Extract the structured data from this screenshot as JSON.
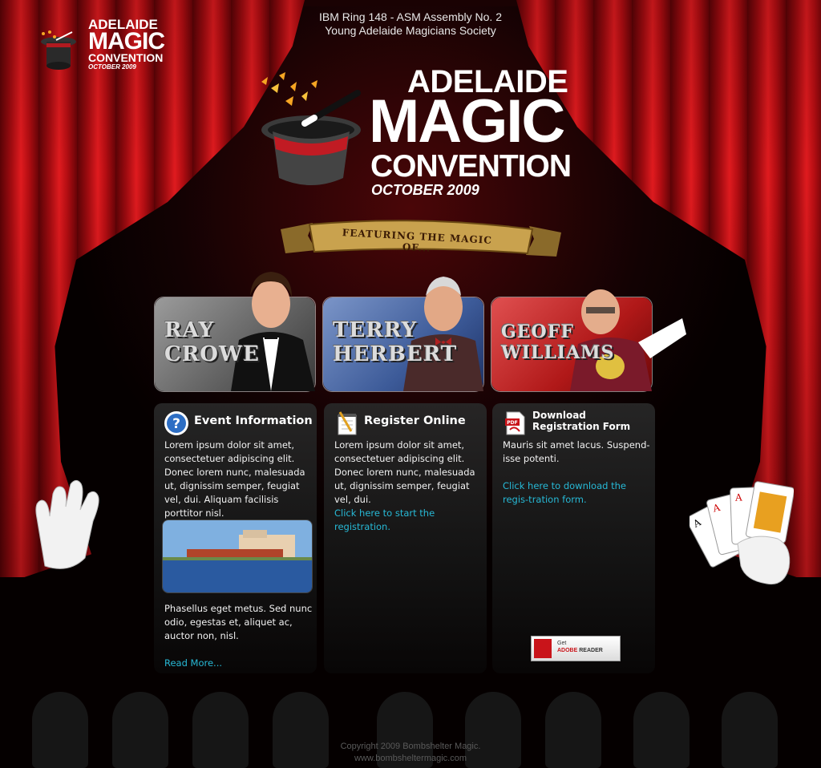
{
  "header": {
    "org_line1": "IBM Ring 148 - ASM Assembly No. 2",
    "org_line2": "Young Adelaide Magicians Society"
  },
  "logo_small": {
    "line1": "ADELAIDE",
    "line2": "MAGIC",
    "line3": "CONVENTION",
    "line4": "OCTOBER 2009"
  },
  "main_logo": {
    "line1": "ADELAIDE",
    "line2": "MAGIC",
    "line3": "CONVENTION",
    "line4": "OCTOBER 2009"
  },
  "banner": {
    "text": "FEATURING THE MAGIC OF..."
  },
  "magicians": [
    {
      "first": "RAY",
      "last": "CROWE"
    },
    {
      "first": "TERRY",
      "last": "HERBERT"
    },
    {
      "first": "GEOFF",
      "last": "WILLIAMS"
    }
  ],
  "panels": {
    "event": {
      "title": "Event Information",
      "icon": "question-icon",
      "text": "Lorem ipsum dolor sit amet, consectetuer adipiscing elit. Donec lorem nunc, malesuada ut, dignissim semper, feugiat vel, dui. Aliquam facilisis porttitor nisl.",
      "text2": "Phasellus eget metus. Sed nunc odio, egestas et, aliquet ac, auctor non, nisl.",
      "link": "Read More..."
    },
    "register": {
      "title": "Register Online",
      "icon": "notepad-icon",
      "text": "Lorem ipsum dolor sit amet, consectetuer adipiscing elit. Donec lorem nunc, malesuada ut, dignissim semper, feugiat vel, dui.",
      "link": "Click here to start the registration."
    },
    "download": {
      "title_line1": "Download",
      "title_line2": "Registration Form",
      "icon": "pdf-icon",
      "text": "Mauris sit amet lacus. Suspend-isse potenti.",
      "link": "Click here to download the regis-tration form.",
      "adobe_get": "Get",
      "adobe_brand": "ADOBE",
      "adobe_reader": "READER"
    }
  },
  "footer": {
    "line1": "Copyright  2009 Bombshelter Magic.",
    "line2": "www.bombsheltermagic.com"
  },
  "colors": {
    "curtain_red": "#e01b1f",
    "link_cyan": "#27b9d6",
    "background": "#000000"
  }
}
